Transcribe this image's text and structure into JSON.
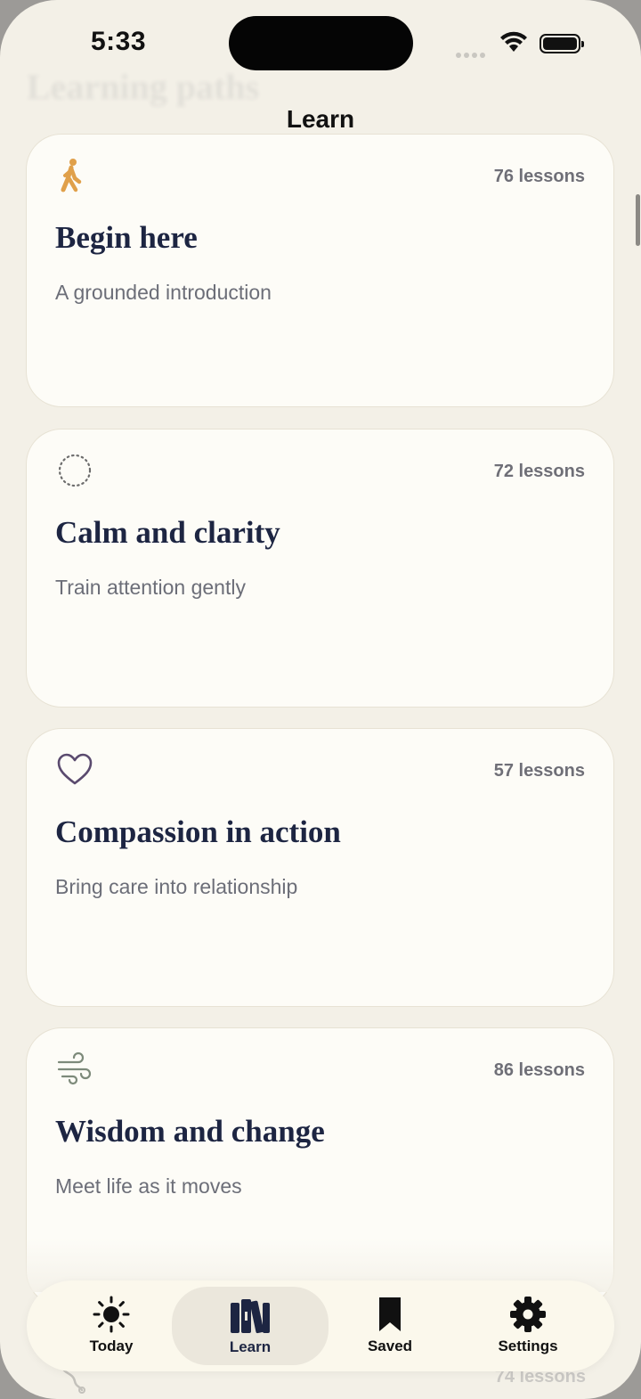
{
  "status_bar": {
    "time": "5:33"
  },
  "header": {
    "background_title": "Learning paths",
    "title": "Learn"
  },
  "paths": [
    {
      "icon": "walking-person-icon",
      "lessons": "76 lessons",
      "title": "Begin here",
      "subtitle": "A grounded introduction",
      "icon_color": "#e0a04a"
    },
    {
      "icon": "dotted-circle-icon",
      "lessons": "72 lessons",
      "title": "Calm and clarity",
      "subtitle": "Train attention gently",
      "icon_color": "#6c6c6c"
    },
    {
      "icon": "heart-icon",
      "lessons": "57 lessons",
      "title": "Compassion in action",
      "subtitle": "Bring care into relationship",
      "icon_color": "#5a4a6e"
    },
    {
      "icon": "wind-icon",
      "lessons": "86 lessons",
      "title": "Wisdom and change",
      "subtitle": "Meet life as it moves",
      "icon_color": "#7d8a7a"
    }
  ],
  "peek_card": {
    "lessons": "74 lessons"
  },
  "tab_bar": {
    "tabs": [
      {
        "label": "Today",
        "icon": "sun-icon",
        "active": false
      },
      {
        "label": "Learn",
        "icon": "books-icon",
        "active": true
      },
      {
        "label": "Saved",
        "icon": "bookmark-icon",
        "active": false
      },
      {
        "label": "Settings",
        "icon": "gear-icon",
        "active": false
      }
    ]
  },
  "colors": {
    "background": "#f3f0e7",
    "card": "#fdfcf7",
    "title_text": "#1d2542",
    "secondary_text": "#6c6e78"
  }
}
